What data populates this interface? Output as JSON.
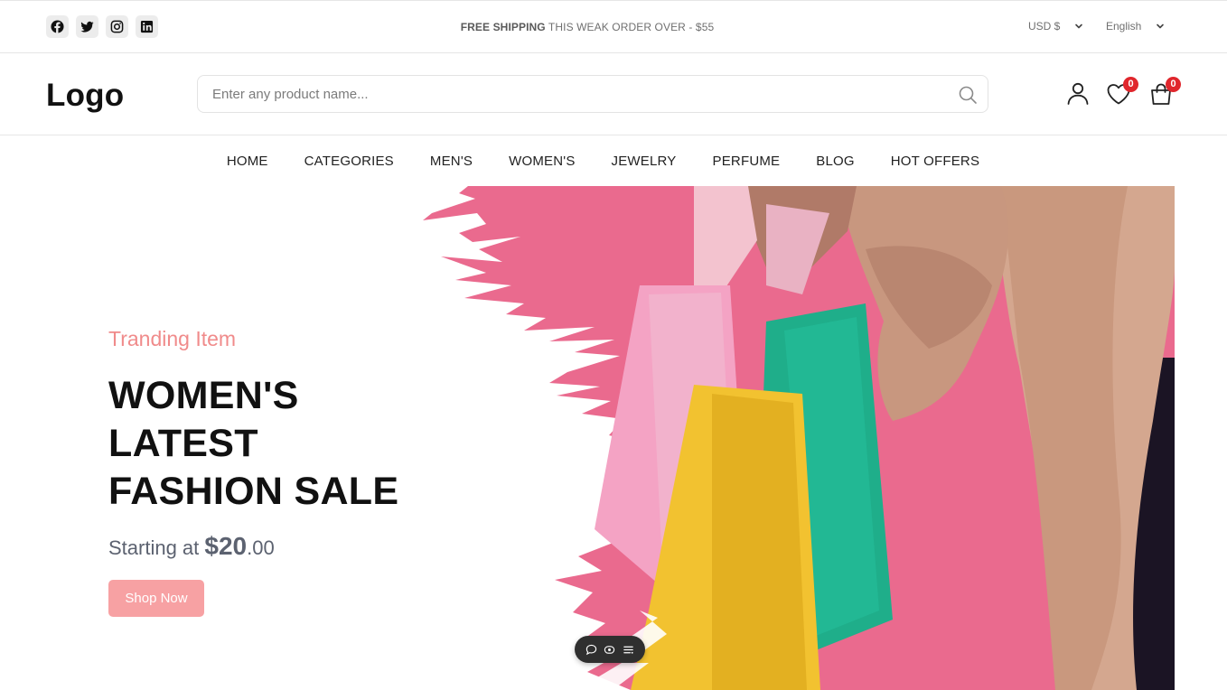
{
  "top_bar": {
    "social_icons": [
      "facebook-icon",
      "twitter-icon",
      "instagram-icon",
      "linkedin-icon"
    ],
    "shipping_bold": "FREE SHIPPING",
    "shipping_text": " THIS WEAK ORDER OVER - $55",
    "currency": "USD $",
    "language": "English"
  },
  "header": {
    "logo": "Logo",
    "search_placeholder": "Enter any product name...",
    "wishlist_count": "0",
    "cart_count": "0"
  },
  "nav": {
    "items": [
      "HOME",
      "CATEGORIES",
      "MEN'S",
      "WOMEN'S",
      "JEWELRY",
      "PERFUME",
      "BLOG",
      "HOT OFFERS"
    ]
  },
  "hero": {
    "subtitle": "Tranding Item",
    "title": "WOMEN'S LATEST FASHION SALE",
    "price_prefix": "Starting at ",
    "price_amount": "$20",
    "price_cents": ".00",
    "button_label": "Shop Now",
    "image": "woman-holding-shopping-bags"
  },
  "colors": {
    "accent_pink": "#f7a1a3",
    "subtitle_pink": "#f08b8b",
    "hero_background_pink": "#ea6a8e",
    "badge_red": "#e0262c",
    "bag_yellow": "#f2c230",
    "bag_green": "#1fae8a",
    "bag_pink": "#f4a3c4",
    "coat_beige": "#d4a78f"
  }
}
